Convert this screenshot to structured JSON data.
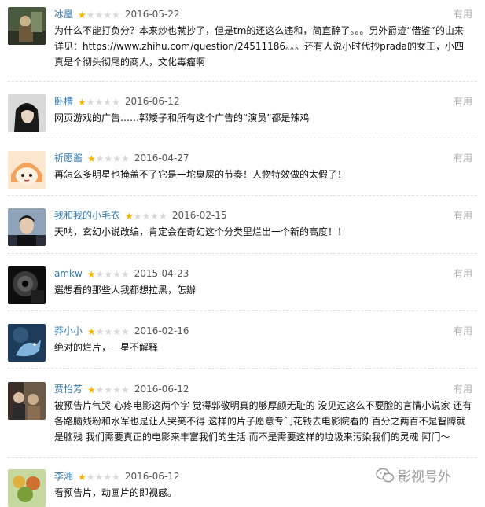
{
  "useful_label": "有用",
  "colors": {
    "username": "#3377aa",
    "star_on": "#f4b400",
    "star_off": "#d9d9d9"
  },
  "reviews": [
    {
      "user": "冰凰",
      "rating": 1,
      "max_rating": 5,
      "date": "2016-05-22",
      "text": "为什么不能打负分？本来炒也就抄了，但是tm的还这么违和，简直醉了。。。另外爵迹“借鉴”的由来详见：https://www.zhihu.com/question/24511186。。。还有人说小时代抄prada的女王，小四真是个彻头彻尾的商人，文化毒瘤啊"
    },
    {
      "user": "卧槽",
      "rating": 1,
      "max_rating": 5,
      "date": "2016-06-12",
      "text": "网页游戏的广告……郭矮子和所有这个广告的“演员”都是辣鸡"
    },
    {
      "user": "祈愿酱",
      "rating": 1,
      "max_rating": 5,
      "date": "2016-04-27",
      "text": "再怎么多明星也掩盖不了它是一坨臭屎的节奏！人物特效做的太假了！"
    },
    {
      "user": "我和我的小毛衣",
      "rating": 1,
      "max_rating": 5,
      "date": "2016-02-15",
      "text": "天呐，玄幻小说改编，肯定会在奇幻这个分类里烂出一个新的高度！！"
    },
    {
      "user": "amkw",
      "rating": 1,
      "max_rating": 5,
      "date": "2015-04-23",
      "text": "選想看的那些人我都想拉黑，怎辦"
    },
    {
      "user": "莽小小",
      "rating": 1,
      "max_rating": 5,
      "date": "2016-02-16",
      "text": "绝对的烂片，一星不解释"
    },
    {
      "user": "贾怡芳",
      "rating": 1,
      "max_rating": 5,
      "date": "2016-06-12",
      "text": "被预告片气哭 心疼电影这两个字 觉得郭敬明真的够厚颜无耻的 没见过这么不要脸的言情小说家 还有各路脑残粉和水军也是让人哭笑不得 这样的片子愿意专门花钱去电影院看的 百分之两百不是智障就是脑残 我们需要真正的电影来丰富我们的生活 而不是需要这样的垃圾来污染我们的灵魂 阿门～"
    },
    {
      "user": "李湘",
      "rating": 1,
      "max_rating": 5,
      "date": "2016-06-12",
      "text": "看预告片，动画片的即视感。"
    }
  ],
  "watermark": {
    "text": "影视号外",
    "icon": "wechat-logo-icon"
  }
}
